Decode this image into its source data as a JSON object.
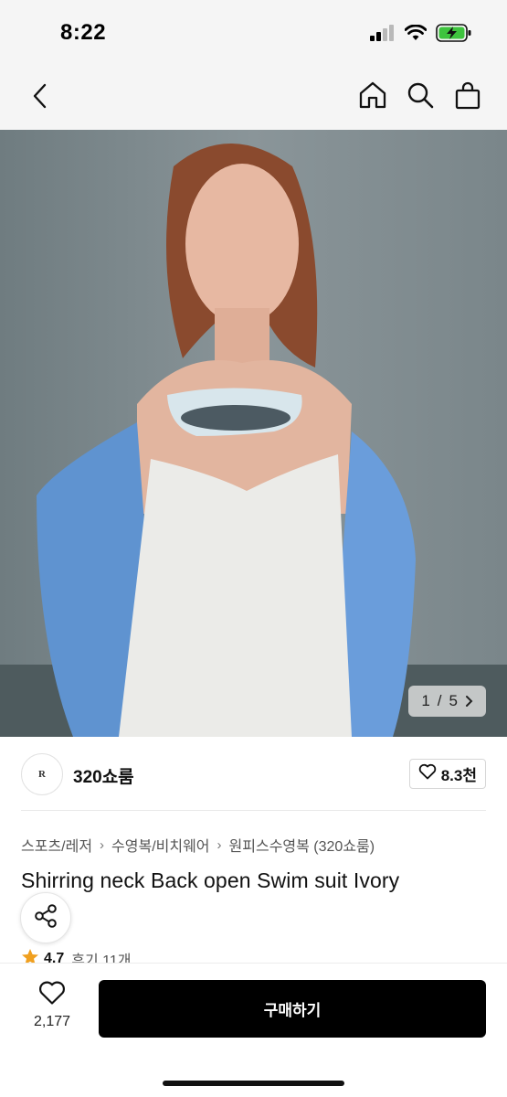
{
  "status": {
    "time": "8:22",
    "icons": [
      "signal-icon",
      "wifi-icon",
      "battery-charging-icon"
    ]
  },
  "nav": {
    "icons": [
      "back-icon",
      "home-icon",
      "search-icon",
      "shopping-bag-icon"
    ]
  },
  "gallery": {
    "current": "1",
    "total": "5",
    "separator": "/"
  },
  "brand": {
    "logo_text": "R",
    "name": "320쇼룸",
    "likes": "8.3천"
  },
  "breadcrumb": {
    "items": [
      "스포츠/레저",
      "수영복/비치웨어",
      "원피스수영복 (320쇼룸)"
    ]
  },
  "product": {
    "title": "Shirring neck Back open Swim suit Ivory"
  },
  "rating": {
    "score": "4.7",
    "reviews": "후기 11개"
  },
  "bottom": {
    "wish_count": "2,177",
    "buy_label": "구매하기"
  },
  "colors": {
    "accent_star": "#f0a020",
    "buy_button": "#000000",
    "battery": "#3ec43e"
  }
}
